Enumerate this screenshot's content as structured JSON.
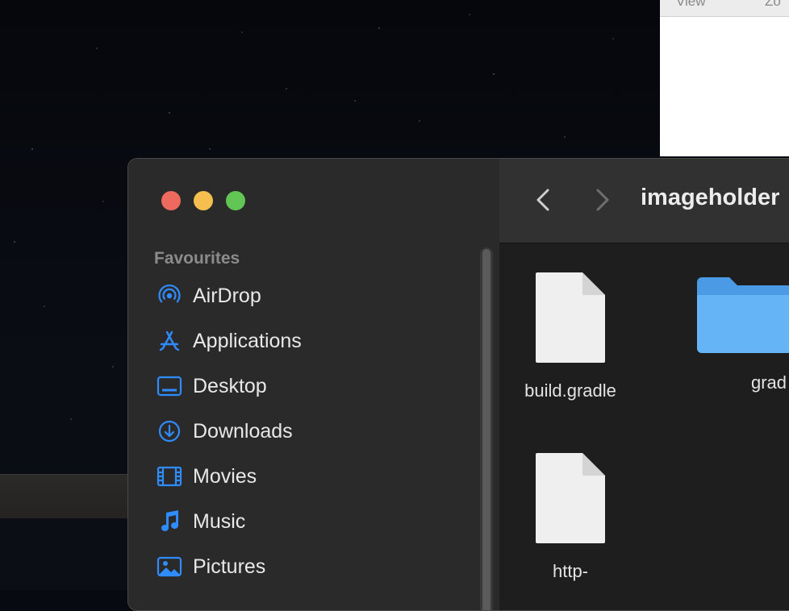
{
  "background_window": {
    "menu": [
      "View",
      "Zo"
    ]
  },
  "finder": {
    "title": "imageholder",
    "sidebar": {
      "section_title": "Favourites",
      "items": [
        {
          "label": "AirDrop",
          "icon": "airdrop-icon"
        },
        {
          "label": "Applications",
          "icon": "applications-icon"
        },
        {
          "label": "Desktop",
          "icon": "desktop-icon"
        },
        {
          "label": "Downloads",
          "icon": "downloads-icon"
        },
        {
          "label": "Movies",
          "icon": "movies-icon"
        },
        {
          "label": "Music",
          "icon": "music-icon"
        },
        {
          "label": "Pictures",
          "icon": "pictures-icon"
        }
      ]
    },
    "files": [
      {
        "name": "build.gradle",
        "icon": "document-icon"
      },
      {
        "name": "grad",
        "icon": "folder-icon"
      },
      {
        "name": "http-",
        "icon": "document-icon"
      }
    ]
  },
  "colors": {
    "accent": "#2f8cff",
    "folder": "#5aaaf0",
    "red_light": "#ee6a5f",
    "yellow_light": "#f5bf4f",
    "green_light": "#62c655"
  }
}
